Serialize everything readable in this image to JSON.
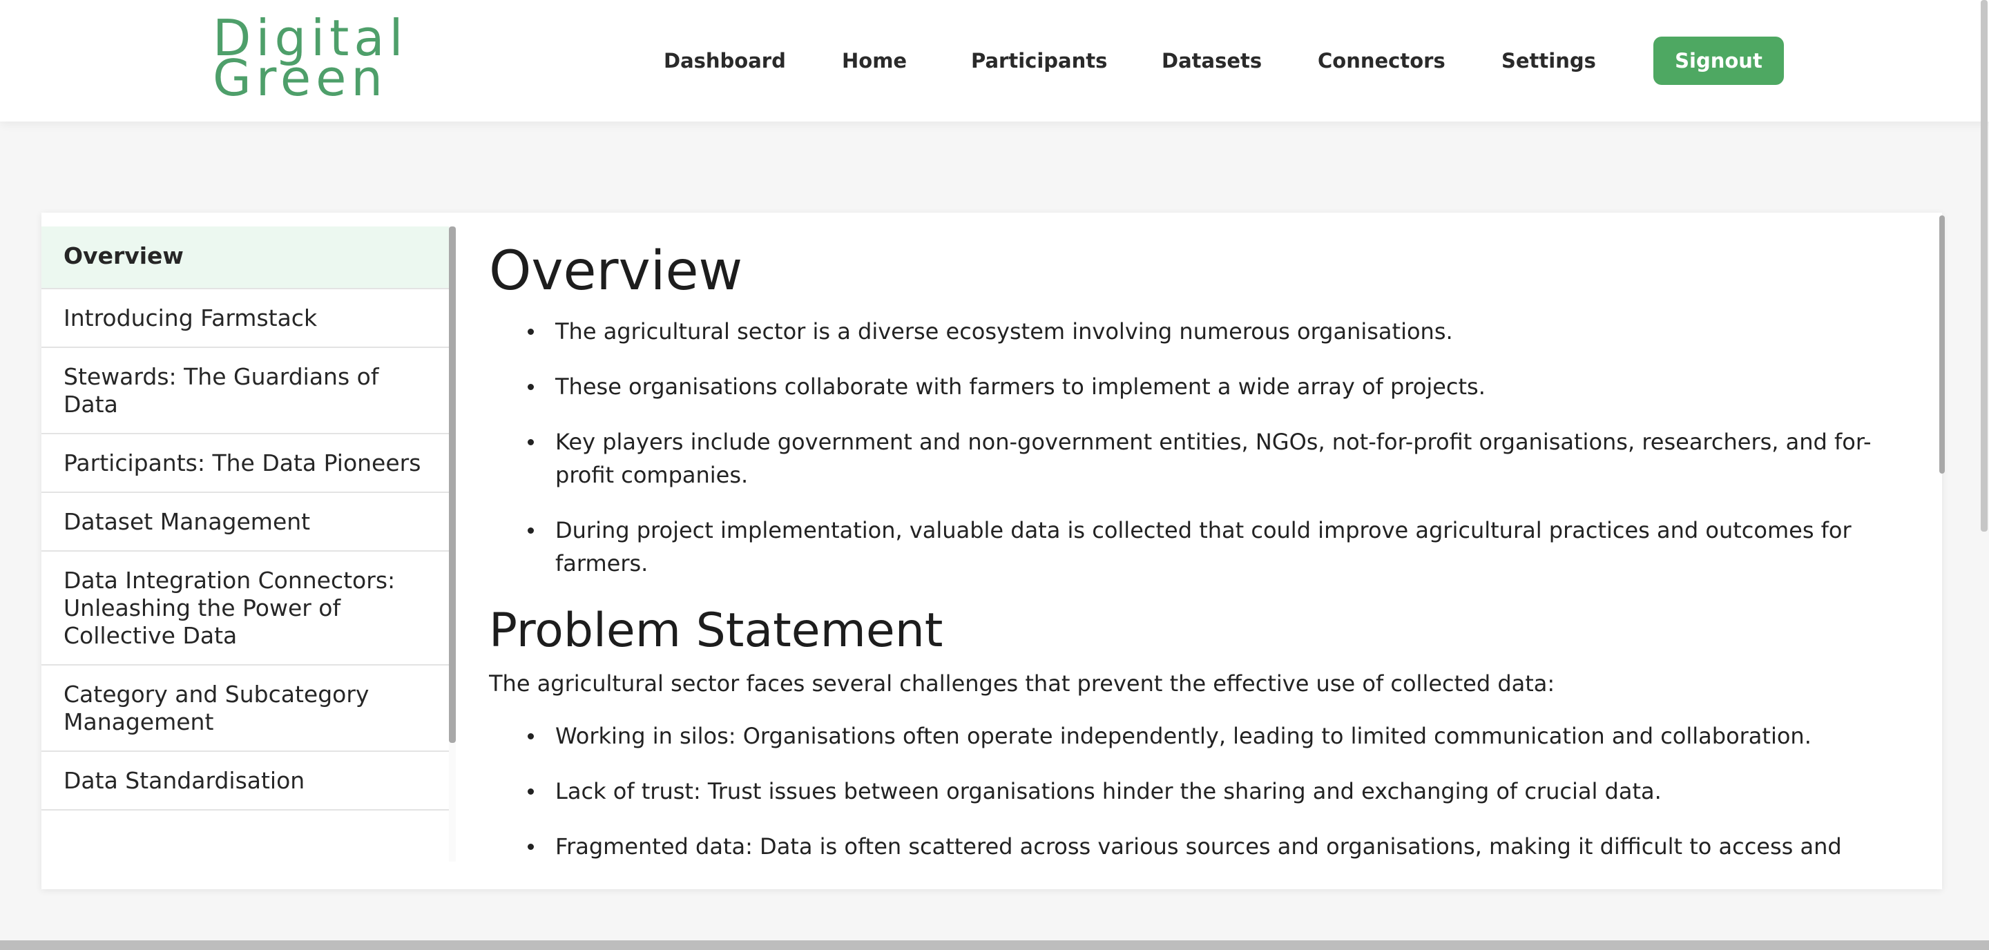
{
  "brand": {
    "logo_line1": "Digital",
    "logo_line2": "Green",
    "color": "#4e9f6a"
  },
  "nav": {
    "items": [
      "Dashboard",
      "Home",
      "Participants",
      "Datasets",
      "Connectors",
      "Settings"
    ],
    "signout_label": "Signout",
    "signout_color": "#4ea862"
  },
  "sidebar": {
    "items": [
      "Overview",
      "Introducing Farmstack",
      "Stewards: The Guardians of Data",
      "Participants: The Data Pioneers",
      "Dataset Management",
      "Data Integration Connectors: Unleashing the Power of Collective Data",
      "Category and Subcategory Management",
      "Data Standardisation"
    ],
    "active_index": 0,
    "active_color": "#ecf8f0"
  },
  "main": {
    "title": "Overview",
    "overview_bullets": [
      "The agricultural sector is a diverse ecosystem involving numerous organisations.",
      "These organisations collaborate with farmers to implement a wide array of projects.",
      "Key players include government and non-government entities, NGOs, not-for-profit organisations, researchers, and for-profit companies.",
      "During project implementation, valuable data is collected that could improve agricultural practices and outcomes for farmers."
    ],
    "problem_heading": "Problem Statement",
    "problem_intro": "The agricultural sector faces several challenges that prevent the effective use of collected data:",
    "problem_bullets": [
      "Working in silos: Organisations often operate independently, leading to limited communication and collaboration.",
      "Lack of trust: Trust issues between organisations hinder the sharing and exchanging of crucial data.",
      "Fragmented data: Data is often scattered across various sources and organisations, making it difficult to access and"
    ]
  }
}
